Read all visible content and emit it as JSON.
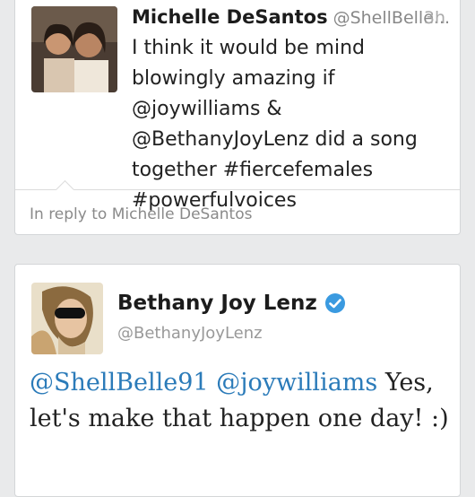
{
  "tweet1": {
    "name": "Michelle DeSantos",
    "handle": "@ShellBelle...",
    "time": "3h",
    "text": "I think it would be mind blowingly amazing if @joywilliams & @BethanyJoyLenz did a song together #fiercefemales #powerfulvoices",
    "reply_context": "In reply to Michelle DeSantos"
  },
  "tweet2": {
    "name": "Bethany Joy Lenz",
    "handle": "@BethanyJoyLenz",
    "mention1": "@ShellBelle91",
    "mention2": "@joywilliams",
    "text": "Yes, let's make that happen one day! :)"
  },
  "colors": {
    "link": "#2b7bb9",
    "verified": "#3a9ae0",
    "background": "#e9eaeb"
  }
}
